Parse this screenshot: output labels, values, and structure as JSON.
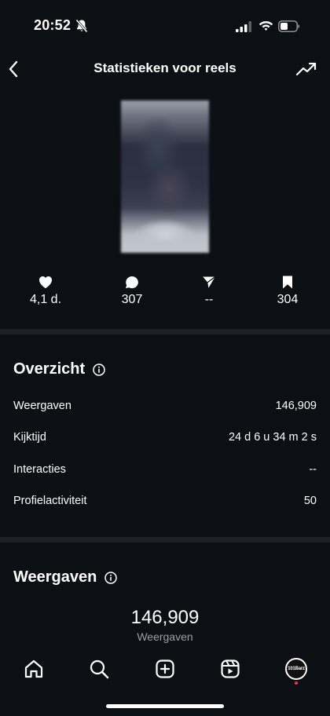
{
  "status_bar": {
    "time": "20:52"
  },
  "header": {
    "title": "Statistieken voor reels"
  },
  "stats": {
    "likes": "4,1 d.",
    "comments": "307",
    "shares": "--",
    "saves": "304"
  },
  "overview": {
    "title": "Overzicht",
    "rows": [
      {
        "label": "Weergaven",
        "value": "146,909"
      },
      {
        "label": "Kijktijd",
        "value": "24 d 6 u 34 m 2 s"
      },
      {
        "label": "Interacties",
        "value": "--"
      },
      {
        "label": "Profielactiviteit",
        "value": "50"
      }
    ]
  },
  "views": {
    "title": "Weergaven",
    "total": "146,909",
    "total_label": "Weergaven"
  },
  "profile": {
    "avatar_text": "101Barz"
  },
  "colors": {
    "background": "#0c0f14",
    "divider": "#1d2127",
    "notification_dot": "#ff3040"
  },
  "icons": [
    "bell-off-icon",
    "signal-icon",
    "wifi-icon",
    "battery-icon",
    "back-icon",
    "trending-icon",
    "heart-icon",
    "comment-icon",
    "send-icon",
    "bookmark-icon",
    "info-icon",
    "home-icon",
    "search-icon",
    "create-icon",
    "reels-icon"
  ]
}
